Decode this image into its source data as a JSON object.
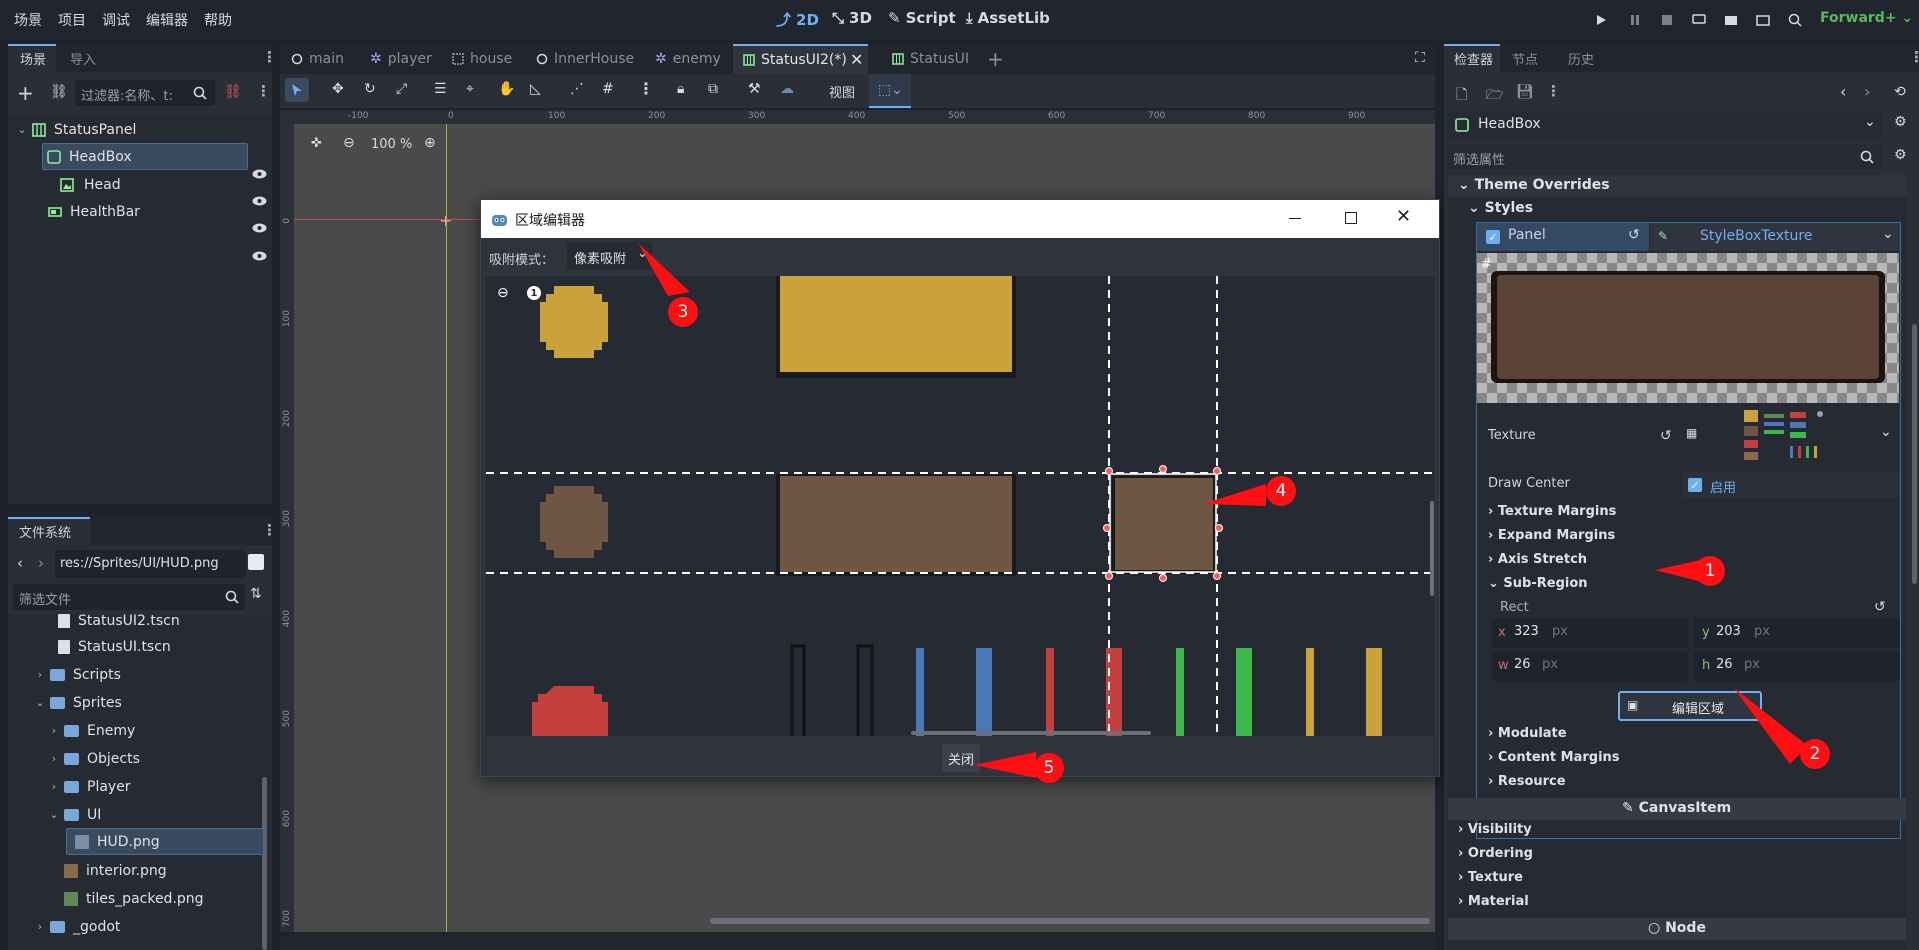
{
  "menu": [
    "场景",
    "项目",
    "调试",
    "编辑器",
    "帮助"
  ],
  "modes": {
    "d2": "2D",
    "d3": "3D",
    "script": "Script",
    "assetlib": "AssetLib"
  },
  "renderer": "Forward+",
  "scene_panel": {
    "tabs": [
      "场景",
      "导入"
    ],
    "filter_placeholder": "过滤器:名称、t:",
    "tree": [
      {
        "label": "StatusPanel"
      },
      {
        "label": "HeadBox"
      },
      {
        "label": "Head"
      },
      {
        "label": "HealthBar"
      }
    ]
  },
  "fs_panel": {
    "title": "文件系统",
    "path": "res://Sprites/UI/HUD.png",
    "filter_placeholder": "筛选文件",
    "items": [
      {
        "label": "StatusUI2.tscn"
      },
      {
        "label": "StatusUI.tscn"
      },
      {
        "label": "Scripts"
      },
      {
        "label": "Sprites"
      },
      {
        "label": "Enemy"
      },
      {
        "label": "Objects"
      },
      {
        "label": "Player"
      },
      {
        "label": "UI"
      },
      {
        "label": "HUD.png"
      },
      {
        "label": "interior.png"
      },
      {
        "label": "tiles_packed.png"
      },
      {
        "label": "_godot"
      }
    ]
  },
  "editor_tabs": [
    "main",
    "player",
    "house",
    "InnerHouse",
    "enemy",
    "StatusUI2(*)",
    "StatusUI"
  ],
  "toolbar": {
    "view_label": "视图"
  },
  "zoom": "100 %",
  "ruler": {
    "h_ticks": [
      "-100",
      "0",
      "100",
      "200",
      "300",
      "400",
      "500",
      "600",
      "700",
      "800",
      "900"
    ],
    "v_ticks": [
      "0",
      "100",
      "200",
      "300",
      "400",
      "500",
      "600",
      "700"
    ]
  },
  "dialog": {
    "title": "区域编辑器",
    "snap_label": "吸附模式：",
    "snap_value": "像素吸附",
    "zoom_reset": "1",
    "close_label": "关闭"
  },
  "inspector": {
    "tabs": [
      "检查器",
      "节点",
      "历史"
    ],
    "node_name": "HeadBox",
    "filter_placeholder": "筛选属性",
    "theme_overrides": "Theme Overrides",
    "styles": "Styles",
    "panel_label": "Panel",
    "stylebox_type": "StyleBoxTexture",
    "texture_label": "Texture",
    "draw_center_label": "Draw Center",
    "draw_center_value": "启用",
    "sections": [
      "Texture Margins",
      "Expand Margins",
      "Axis Stretch",
      "Sub-Region"
    ],
    "rect_label": "Rect",
    "rect": {
      "x": "323",
      "y": "203",
      "w": "26",
      "h": "26",
      "unit": "px"
    },
    "edit_region_button": "编辑区域",
    "more_sections": [
      "Modulate",
      "Content Margins",
      "Resource"
    ],
    "canvas_item": "CanvasItem",
    "canvas_sections": [
      "Visibility",
      "Ordering",
      "Texture",
      "Material"
    ],
    "node_section": "Node"
  },
  "callouts": [
    "1",
    "2",
    "3",
    "4",
    "5"
  ]
}
